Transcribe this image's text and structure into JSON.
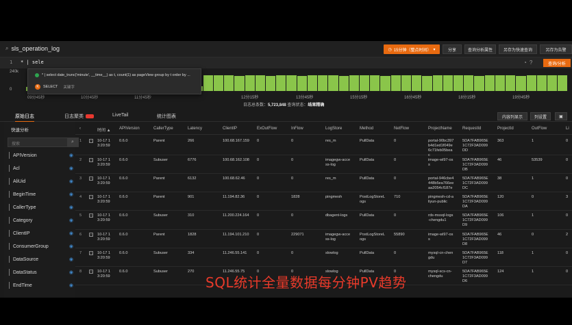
{
  "header": {
    "logstore_name": "sls_operation_log",
    "time_range": "15分钟（整点时间）",
    "share": "分享",
    "query_attributes": "查询分析属性",
    "save_quick_query": "另存为快速查询",
    "save_alert": "另存为告警"
  },
  "query": {
    "line_number": "1",
    "text": "* | sele",
    "search_button": "查询/分析"
  },
  "autocomplete": {
    "suggestion": "* | select date_trunc('minute', __time__) as t, count(1) as pageView group by t order by ...",
    "keyword_label": "SELECT",
    "keyword_type": "关键字",
    "keyword_icon": "K"
  },
  "histogram": {
    "y_labels": [
      "240k",
      "0"
    ],
    "x_ticks": [
      "09分45秒",
      "10分45秒",
      "11分45秒",
      "12分15秒",
      "13分45秒",
      "15分15秒",
      "16分45秒",
      "18分15秒",
      "19分45秒"
    ],
    "bar_values": [
      0.25,
      0.3,
      0.2,
      0.35,
      0.4,
      0.3,
      0.2,
      0.25,
      0.3,
      0.2,
      0.35,
      0.3,
      0.4,
      0.25,
      0.3,
      0.2,
      0.3,
      1,
      1,
      1,
      0.95,
      1,
      1,
      0.95,
      1,
      1,
      0.95,
      1,
      1,
      1,
      0.95,
      1,
      1,
      1,
      0.95,
      1,
      1,
      1,
      0.95,
      1,
      1,
      1,
      1,
      0.95,
      1,
      1,
      1,
      0.95,
      1,
      1,
      1,
      1
    ],
    "summary_label": "日志总条数：",
    "summary_count": "5,723,848",
    "status_label": "查询状态：",
    "status_value": "结果精确"
  },
  "tabs": [
    {
      "label": "原始日志",
      "active": true
    },
    {
      "label": "日志聚类",
      "badge": true
    },
    {
      "label": "LiveTail"
    },
    {
      "label": "统计图表"
    }
  ],
  "right_buttons": {
    "content_wrap": "内容列显示",
    "column_settings": "列设置"
  },
  "sidebar": {
    "title": "快速分析",
    "search_placeholder": "搜索",
    "fields": [
      "APIVersion",
      "Acl",
      "AliUid",
      "BeginTime",
      "CallerType",
      "Category",
      "ClientIP",
      "ConsumerGroup",
      "DataSource",
      "DataStatus",
      "EndTime"
    ]
  },
  "table": {
    "headers": [
      "时间 ▲",
      "APIVersion",
      "CallerType",
      "Latency",
      "ClientIP",
      "ExOutFlow",
      "InFlow",
      "LogStore",
      "Method",
      "NetFlow",
      "ProjectName",
      "RequestId",
      "ProjectId",
      "OutFlow",
      "Li"
    ],
    "rows": [
      {
        "n": "1",
        "time": "10-17 1\n3:20:59",
        "api": "0.6.0",
        "caller": "Parent",
        "latency": "266",
        "ip": "100.68.167.159",
        "ex": "0",
        "in": "0",
        "store": "res_m",
        "method": "PullData",
        "net": "0",
        "project": "portal-90bc397\nb4d1ed1f049e\n6c71feb05bea\nc",
        "reqid": "5DA7FAB965E\n1C72F3AD099\nDD",
        "pid": "363",
        "out": "1",
        "li": "0"
      },
      {
        "n": "2",
        "time": "10-17 1\n3:20:59",
        "api": "0.6.0",
        "caller": "Subuser",
        "latency": "6776",
        "ip": "100.68.162.108",
        "ex": "0",
        "in": "0",
        "store": "imagegw-acce\nss-log",
        "method": "PullData",
        "net": "0",
        "project": "image-wl97-os\ns",
        "reqid": "5DA7FAB965E\n1C72F3AD099\nDB",
        "pid": "46",
        "out": "53539",
        "li": "0"
      },
      {
        "n": "3",
        "time": "10-17 1\n3:20:59",
        "api": "0.6.0",
        "caller": "Parent",
        "latency": "6132",
        "ip": "100.68.62.46",
        "ex": "0",
        "in": "0",
        "store": "res_m",
        "method": "PullData",
        "net": "0",
        "project": "portal-946cbe4\n448b5ea766ee\naa2054cf187e",
        "reqid": "5DA7FAB965E\n1C72F3AD099\nDC",
        "pid": "38",
        "out": "1",
        "li": "0"
      },
      {
        "n": "4",
        "time": "10-17 1\n3:20:59",
        "api": "0.6.0",
        "caller": "Parent",
        "latency": "901",
        "ip": "11.194.82.36",
        "ex": "0",
        "in": "1828",
        "store": "pingmesh",
        "method": "PostLogStoreL\nogs",
        "net": "710",
        "project": "pingmesh-cd-a\nliyun-public",
        "reqid": "5DA7FAB965E\n1C72F3AD099\nDA",
        "pid": "120",
        "out": "0",
        "li": "3"
      },
      {
        "n": "5",
        "time": "10-17 1\n3:20:59",
        "api": "0.6.0",
        "caller": "Subuser",
        "latency": "310",
        "ip": "11.200.224.164",
        "ex": "0",
        "in": "0",
        "store": "dbagent-logs",
        "method": "PullData",
        "net": "0",
        "project": "rds-mssql-logs\n-chengdu1",
        "reqid": "5DA7FAB965E\n1C72F3AD099\nD9",
        "pid": "106",
        "out": "1",
        "li": "0"
      },
      {
        "n": "6",
        "time": "10-17 1\n3:20:59",
        "api": "0.6.0",
        "caller": "Parent",
        "latency": "1828",
        "ip": "11.194.101.210",
        "ex": "0",
        "in": "229071",
        "store": "imagegw-acce\nss-log",
        "method": "PostLogStoreL\nogs",
        "net": "55890",
        "project": "image-wl97-os\ns",
        "reqid": "5DA7FAB965E\n1C72F3AD099\nD8",
        "pid": "46",
        "out": "0",
        "li": "2"
      },
      {
        "n": "7",
        "time": "10-17 1\n3:20:59",
        "api": "0.6.0",
        "caller": "Subuser",
        "latency": "334",
        "ip": "11.246.55.141",
        "ex": "0",
        "in": "0",
        "store": "slowlog",
        "method": "PullData",
        "net": "0",
        "project": "mysql-cn-chen\ngdu",
        "reqid": "5DA7FAB965E\n1C72F3AD099\nD7",
        "pid": "118",
        "out": "1",
        "li": "0"
      },
      {
        "n": "8",
        "time": "10-17 1\n3:20:59",
        "api": "0.6.0",
        "caller": "Subuser",
        "latency": "270",
        "ip": "11.246.55.75",
        "ex": "0",
        "in": "0",
        "store": "slowlog",
        "method": "PullData",
        "net": "0",
        "project": "mysql-scs-cn-\nchengdu",
        "reqid": "5DA7FAB965E\n1C72F3AD099\nD6",
        "pid": "124",
        "out": "1",
        "li": "0"
      }
    ]
  },
  "overlay_caption": "SQL统计全量数据每分钟PV趋势",
  "colors": {
    "accent": "#e86a10",
    "bar": "#8ac54a",
    "eye": "#3f86c8",
    "caption": "#e83a2a"
  }
}
